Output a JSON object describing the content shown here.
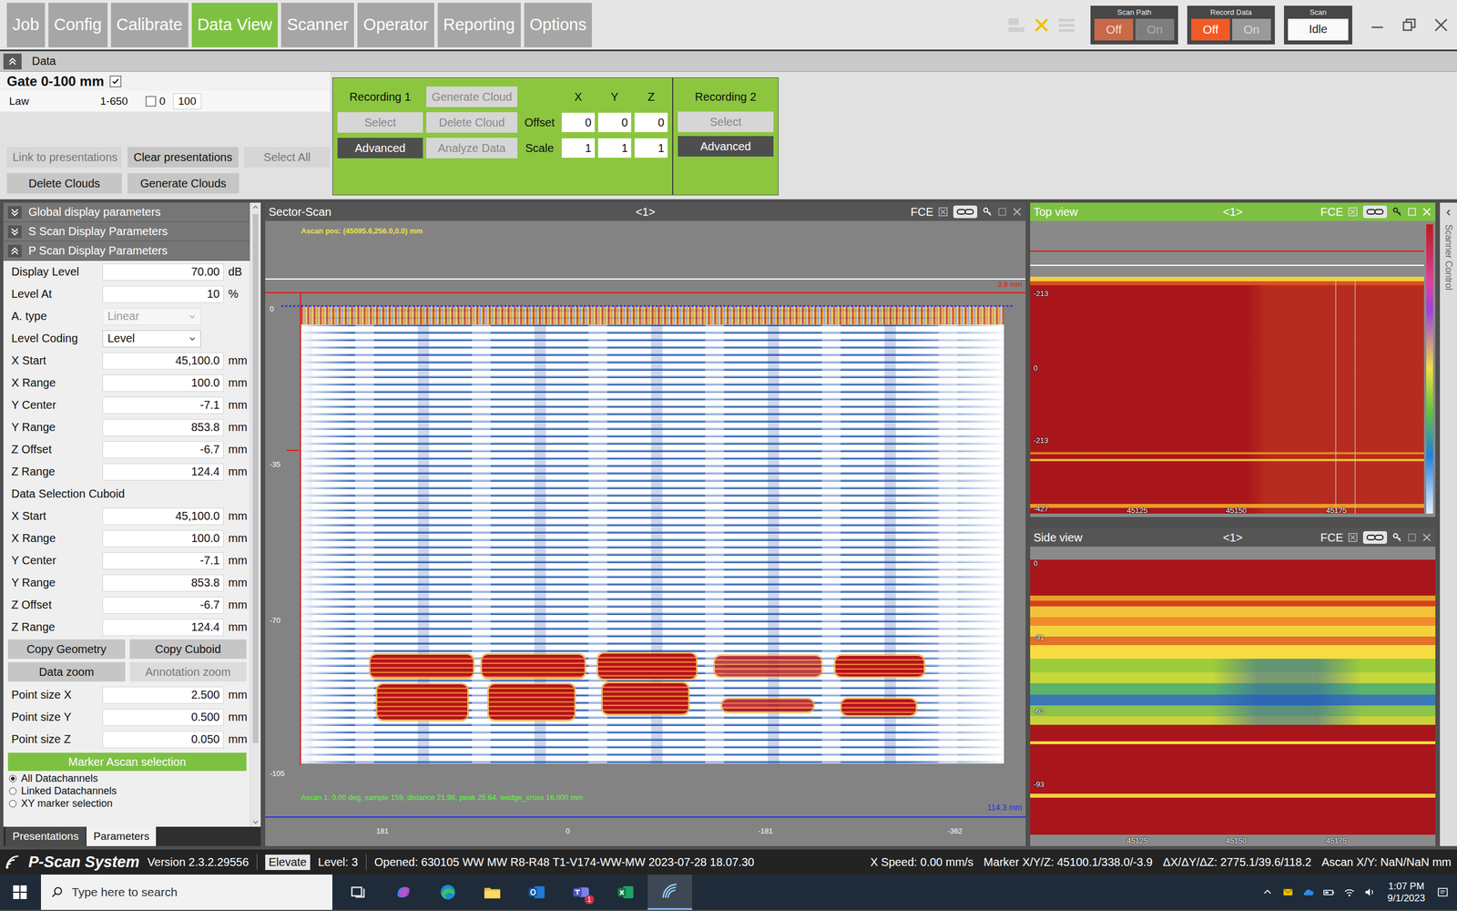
{
  "menu_tabs": [
    {
      "label": "Job",
      "selected": false
    },
    {
      "label": "Config",
      "selected": false
    },
    {
      "label": "Calibrate",
      "selected": false
    },
    {
      "label": "Data View",
      "selected": true
    },
    {
      "label": "Scanner",
      "selected": false
    },
    {
      "label": "Operator",
      "selected": false
    },
    {
      "label": "Reporting",
      "selected": false
    },
    {
      "label": "Options",
      "selected": false
    }
  ],
  "toggles": [
    {
      "title": "Scan Path",
      "disabled": true,
      "options": [
        {
          "label": "Off",
          "selected": true
        },
        {
          "label": "On",
          "selected": false
        }
      ]
    },
    {
      "title": "Record Data",
      "disabled": false,
      "options": [
        {
          "label": "Off",
          "selected": true
        },
        {
          "label": "On",
          "selected": false
        }
      ]
    }
  ],
  "scan": {
    "title": "Scan",
    "value": "Idle"
  },
  "data_panel": {
    "title": "Data",
    "expanded": true
  },
  "gate": {
    "label": "Gate 0-100 mm",
    "checked": true,
    "law_label": "Law",
    "law_range": "1-650",
    "law_checked": false,
    "law_from": "0",
    "law_to": "100"
  },
  "gate_buttons": [
    [
      {
        "label": "Link to presentations",
        "disabled": true
      },
      {
        "label": "Clear presentations",
        "disabled": false
      },
      {
        "label": "Select All",
        "disabled": true
      }
    ],
    [
      {
        "label": "Delete Clouds",
        "disabled": false
      },
      {
        "label": "Generate Clouds",
        "disabled": false
      }
    ]
  ],
  "recording": {
    "rec1": {
      "title": "Recording 1",
      "select": {
        "label": "Select",
        "disabled": true
      },
      "advanced": {
        "label": "Advanced",
        "disabled": false
      }
    },
    "cloud_buttons": [
      {
        "label": "Generate Cloud",
        "disabled": true
      },
      {
        "label": "Delete Cloud",
        "disabled": true
      },
      {
        "label": "Analyze Data",
        "disabled": true
      }
    ],
    "axes": [
      "X",
      "Y",
      "Z"
    ],
    "rows": [
      {
        "label": "Offset",
        "values": [
          "0",
          "0",
          "0"
        ]
      },
      {
        "label": "Scale",
        "values": [
          "1",
          "1",
          "1"
        ]
      }
    ],
    "rec2": {
      "title": "Recording 2",
      "select": {
        "label": "Select",
        "disabled": true
      },
      "advanced": {
        "label": "Advanced",
        "disabled": false
      }
    }
  },
  "params": {
    "sections": [
      {
        "title": "Global display parameters",
        "expanded": false
      },
      {
        "title": "S Scan Display Parameters",
        "expanded": false
      },
      {
        "title": "P Scan Display Parameters",
        "expanded": true
      }
    ],
    "rows": [
      {
        "kind": "field",
        "label": "Display Level",
        "value": "70.00",
        "unit": "dB",
        "disabled": false
      },
      {
        "kind": "field",
        "label": "Level At",
        "value": "10",
        "unit": "%",
        "disabled": false
      },
      {
        "kind": "select",
        "label": "A. type",
        "value": "Linear",
        "unit": "",
        "disabled": true
      },
      {
        "kind": "select",
        "label": "Level Coding",
        "value": "Level",
        "unit": "",
        "disabled": false
      },
      {
        "kind": "field",
        "label": "X Start",
        "value": "45,100.0",
        "unit": "mm",
        "disabled": false
      },
      {
        "kind": "field",
        "label": "X Range",
        "value": "100.0",
        "unit": "mm",
        "disabled": false
      },
      {
        "kind": "field",
        "label": "Y Center",
        "value": "-7.1",
        "unit": "mm",
        "disabled": false
      },
      {
        "kind": "field",
        "label": "Y Range",
        "value": "853.8",
        "unit": "mm",
        "disabled": false
      },
      {
        "kind": "field",
        "label": "Z Offset",
        "value": "-6.7",
        "unit": "mm",
        "disabled": false
      },
      {
        "kind": "field",
        "label": "Z Range",
        "value": "124.4",
        "unit": "mm",
        "disabled": false
      }
    ],
    "cuboid_title": "Data Selection Cuboid",
    "cuboid_rows": [
      {
        "label": "X Start",
        "value": "45,100.0",
        "unit": "mm"
      },
      {
        "label": "X Range",
        "value": "100.0",
        "unit": "mm"
      },
      {
        "label": "Y Center",
        "value": "-7.1",
        "unit": "mm"
      },
      {
        "label": "Y Range",
        "value": "853.8",
        "unit": "mm"
      },
      {
        "label": "Z Offset",
        "value": "-6.7",
        "unit": "mm"
      },
      {
        "label": "Z Range",
        "value": "124.4",
        "unit": "mm"
      }
    ],
    "action_buttons": [
      [
        {
          "label": "Copy Geometry",
          "disabled": false
        },
        {
          "label": "Copy Cuboid",
          "disabled": false
        }
      ],
      [
        {
          "label": "Data zoom",
          "disabled": false
        },
        {
          "label": "Annotation zoom",
          "disabled": true
        }
      ]
    ],
    "point_rows": [
      {
        "label": "Point size X",
        "value": "2.500",
        "unit": "mm"
      },
      {
        "label": "Point size Y",
        "value": "0.500",
        "unit": "mm"
      },
      {
        "label": "Point size Z",
        "value": "0.050",
        "unit": "mm"
      }
    ],
    "marker_title": "Marker Ascan selection",
    "radios": [
      {
        "label": "All Datachannels",
        "selected": true
      },
      {
        "label": "Linked Datachannels",
        "selected": false
      },
      {
        "label": "XY marker selection",
        "selected": false
      }
    ],
    "bottom_tabs": [
      {
        "label": "Presentations",
        "selected": false
      },
      {
        "label": "Parameters",
        "selected": true
      }
    ]
  },
  "sector": {
    "title": "Sector-Scan",
    "index": "<1>",
    "tag": "FCE",
    "ascan_pos": "Ascan pos: (45095.6,256.0,0.0) mm",
    "top_reading": "3.9 mm",
    "bottom_reading": "114.3 mm",
    "y_ticks": [
      "0",
      "-35",
      "-70",
      "-105"
    ],
    "x_ticks": [
      "181",
      "0",
      "-181",
      "-362"
    ],
    "ascan_info": "Ascan 1, 0.00 deg, sample 159, distance 21.98, peak 25.64, wedge_cross 16.000 mm"
  },
  "top_view": {
    "title": "Top view",
    "index": "<1>",
    "tag": "FCE",
    "selected": true,
    "y_ticks": [
      "-213",
      "0",
      "-213",
      "-427"
    ],
    "x_ticks": [
      "45125",
      "45150",
      "45175"
    ]
  },
  "side_view": {
    "title": "Side view",
    "index": "<1>",
    "tag": "FCE",
    "selected": false,
    "y_ticks": [
      "0",
      "-31",
      "-62",
      "-93"
    ],
    "x_ticks": [
      "45125",
      "45150",
      "45175"
    ]
  },
  "side_panel": {
    "icon": "‹",
    "label": "Scanner Control"
  },
  "status_bar": {
    "app": "P-Scan System",
    "version": "Version 2.3.2.29556",
    "elevate": "Elevate",
    "level": "Level: 3",
    "opened": "Opened: 630105 WW MW R8-R48 T1-V174-WW-MW 2023-07-28 18.07.30",
    "speed": "X Speed: 0.00 mm/s",
    "marker": "Marker X/Y/Z: 45100.1/338.0/-3.9",
    "delta": "ΔX/ΔY/ΔZ: 2775.1/39.6/118.2",
    "ascan": "Ascan X/Y: NaN/NaN mm"
  },
  "taskbar": {
    "search_placeholder": "Type here to search",
    "apps": [
      {
        "kind": "taskview",
        "active": false,
        "badge": ""
      },
      {
        "kind": "copilot",
        "active": false,
        "badge": ""
      },
      {
        "kind": "edge",
        "active": false,
        "badge": ""
      },
      {
        "kind": "explorer",
        "active": false,
        "badge": ""
      },
      {
        "kind": "outlook",
        "active": false,
        "badge": ""
      },
      {
        "kind": "teams",
        "active": false,
        "badge": "1"
      },
      {
        "kind": "excel",
        "active": false,
        "badge": ""
      },
      {
        "kind": "pscan",
        "active": true,
        "badge": ""
      }
    ],
    "time": "1:07 PM",
    "date": "9/1/2023"
  }
}
